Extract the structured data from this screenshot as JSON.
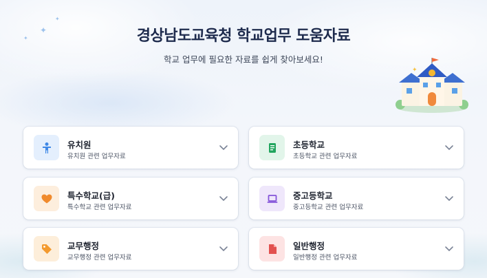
{
  "header": {
    "title": "경상남도교육청 학교업무 도움자료",
    "subtitle": "학교 업무에 필요한 자료를 쉽게 찾아보세요!"
  },
  "categories": [
    {
      "label": "유치원",
      "desc": "유치원 관련 업무자료",
      "icon": "child-icon",
      "color": "#3f88e6",
      "bg": "#e4effd"
    },
    {
      "label": "초등학교",
      "desc": "초등학교 관련 업무자료",
      "icon": "book-icon",
      "color": "#21a55e",
      "bg": "#e2f5ea"
    },
    {
      "label": "특수학교(급)",
      "desc": "특수학교 관련 업무자료",
      "icon": "heart-icon",
      "color": "#f08a2c",
      "bg": "#fdeedd"
    },
    {
      "label": "중고등학교",
      "desc": "중고등학교 관련 업무자료",
      "icon": "laptop-icon",
      "color": "#8454d9",
      "bg": "#efe7fb"
    },
    {
      "label": "교무행정",
      "desc": "교무행정 관련 업무자료",
      "icon": "tag-icon",
      "color": "#f39a2e",
      "bg": "#fdeeda"
    },
    {
      "label": "일반행정",
      "desc": "일반행정 관련 업무자료",
      "icon": "document-icon",
      "color": "#e2514f",
      "bg": "#fde3e3"
    }
  ]
}
